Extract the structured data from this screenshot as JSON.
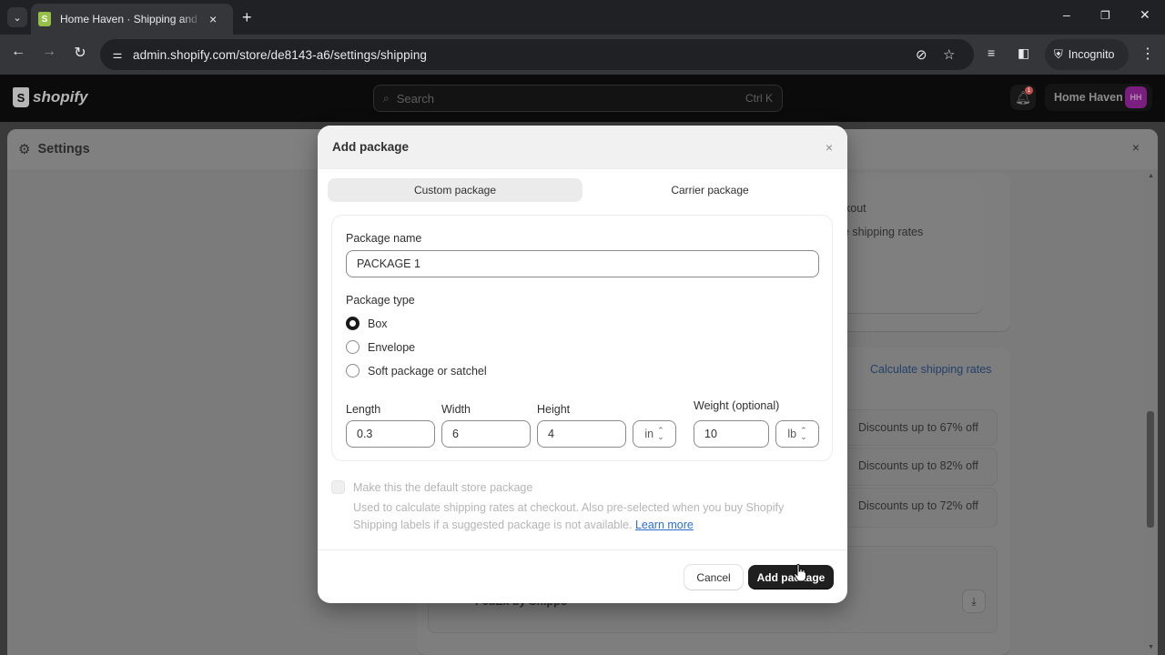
{
  "browser": {
    "tab_search_icon": "chevron-down",
    "tab": {
      "title": "Home Haven · Shipping and delivery",
      "favicon": "shopify-bag",
      "close": "×"
    },
    "new_tab": "+",
    "window_controls": {
      "minimize": "–",
      "restore": "❐",
      "close": "✕"
    },
    "nav": {
      "back": "←",
      "forward": "→",
      "reload": "↻"
    },
    "site_info_icon": "⚌",
    "url": "admin.shopify.com/store/de8143-a6/settings/shipping",
    "omnibox_icons": {
      "tracking_protection": "⊘",
      "bookmark": "☆"
    },
    "toolbar_icons": {
      "media": "≡",
      "side_panel": "◧",
      "menu": "⋮"
    },
    "incognito": {
      "icon": "🕶",
      "label": "Incognito"
    }
  },
  "shopify_bar": {
    "logo_text": "shopify",
    "logo_glyph": "S",
    "search": {
      "placeholder": "Search",
      "shortcut": "Ctrl K",
      "icon": "⌕"
    },
    "notifications": {
      "icon": "🔔",
      "badge_count": "1"
    },
    "store": {
      "name": "Home Haven",
      "initials": "HH",
      "avatar_color": "#7a1f7d"
    }
  },
  "settings": {
    "title": "Settings",
    "gear_icon": "⚙",
    "close": "×",
    "background": {
      "checkout_text": "kout",
      "shipping_rates_text": "e shipping rates",
      "calculate_link": "Calculate shipping rates",
      "discounts": [
        "Discounts up to 67% off",
        "Discounts up to 82% off",
        "Discounts up to 72% off"
      ],
      "carrier_partial": "FedEx by Shippo",
      "download_icon": "⤓"
    }
  },
  "modal": {
    "title": "Add package",
    "close": "×",
    "tabs": [
      {
        "label": "Custom package",
        "active": true
      },
      {
        "label": "Carrier package",
        "active": false
      }
    ],
    "package_name": {
      "label": "Package name",
      "value": "PACKAGE 1"
    },
    "package_type": {
      "label": "Package type",
      "options": [
        {
          "label": "Box",
          "selected": true
        },
        {
          "label": "Envelope",
          "selected": false
        },
        {
          "label": "Soft package or satchel",
          "selected": false
        }
      ]
    },
    "dimensions": {
      "length": {
        "label": "Length",
        "value": "0.3"
      },
      "width": {
        "label": "Width",
        "value": "6"
      },
      "height": {
        "label": "Height",
        "value": "4"
      },
      "unit": "in"
    },
    "weight": {
      "label": "Weight (optional)",
      "value": "10",
      "unit": "lb"
    },
    "default_package": {
      "label": "Make this the default store package",
      "checked": false,
      "disabled": true,
      "help": "Used to calculate shipping rates at checkout. Also pre-selected when you buy Shopify Shipping labels if a suggested package is not available.",
      "learn_more": "Learn more"
    },
    "footer": {
      "cancel": "Cancel",
      "submit": "Add package"
    }
  },
  "colors": {
    "primary_button": "#1f1f1f",
    "link": "#2c6ecb",
    "shopify_green": "#95bf47"
  }
}
